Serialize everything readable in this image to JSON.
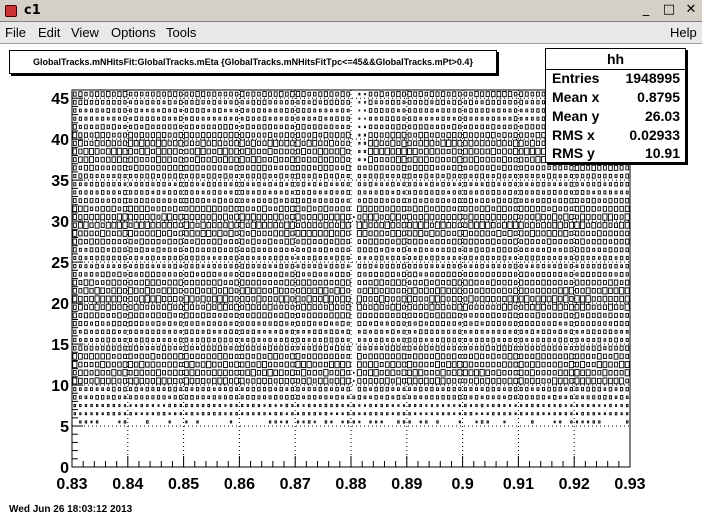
{
  "window": {
    "title": "c1",
    "buttons": [
      "_",
      "□",
      "✕"
    ]
  },
  "menu": {
    "left": [
      "File",
      "Edit",
      "View",
      "Options",
      "Tools"
    ],
    "right": "Help"
  },
  "plot": {
    "title": "GlobalTracks.mNHitsFit:GlobalTracks.mEta {GlobalTracks.mNHitsFitTpc<=45&&GlobalTracks.mPt>0.4}"
  },
  "stats": {
    "name": "hh",
    "rows": [
      {
        "label": "Entries",
        "value": "1948995"
      },
      {
        "label": "Mean x",
        "value": "0.8795"
      },
      {
        "label": "Mean y",
        "value": "26.03"
      },
      {
        "label": "RMS x",
        "value": "0.02933"
      },
      {
        "label": "RMS y",
        "value": "10.91"
      }
    ]
  },
  "datestamp": "Wed Jun 26 18:03:12 2013",
  "chart_data": {
    "type": "heatmap",
    "title": "GlobalTracks.mNHitsFit:GlobalTracks.mEta {GlobalTracks.mNHitsFitTpc<=45&&GlobalTracks.mPt>0.4}",
    "xlabel": "",
    "ylabel": "",
    "xlim": [
      0.83,
      0.93
    ],
    "ylim": [
      0,
      46
    ],
    "x_ticks": [
      "0.83",
      "0.84",
      "0.85",
      "0.86",
      "0.87",
      "0.88",
      "0.89",
      "0.9",
      "0.91",
      "0.92",
      "0.93"
    ],
    "y_ticks": [
      "0",
      "5",
      "10",
      "15",
      "20",
      "25",
      "30",
      "35",
      "40",
      "45"
    ],
    "grid": true,
    "draw_option": "box",
    "x_bins": 100,
    "y_range_filled": [
      5,
      45
    ],
    "legend": "stats box top-right"
  }
}
